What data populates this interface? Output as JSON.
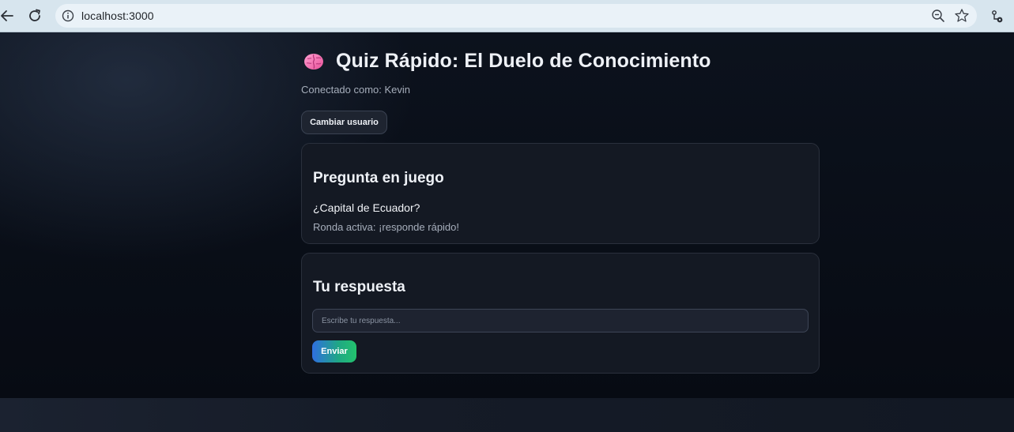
{
  "browser": {
    "url": "localhost:3000",
    "icons": [
      "back-arrow-icon",
      "reload-icon",
      "info-icon",
      "zoom-out-icon",
      "star-icon",
      "extension-icon"
    ]
  },
  "header": {
    "title_emoji_icon": "brain-icon",
    "title": "Quiz Rápido: El Duelo de Conocimiento",
    "connected_as": "Conectado como: Kevin",
    "switch_user_label": "Cambiar usuario"
  },
  "question_card": {
    "heading": "Pregunta en juego",
    "question": "¿Capital de Ecuador?",
    "status": "Ronda activa: ¡responde rápido!"
  },
  "answer_card": {
    "heading": "Tu respuesta",
    "input_value": "",
    "input_placeholder": "Escribe tu respuesta...",
    "send_label": "Enviar"
  },
  "colors": {
    "background": "#0c111b",
    "card": "#141923",
    "accent_start": "#2f6fe0",
    "accent_end": "#23c26d"
  }
}
